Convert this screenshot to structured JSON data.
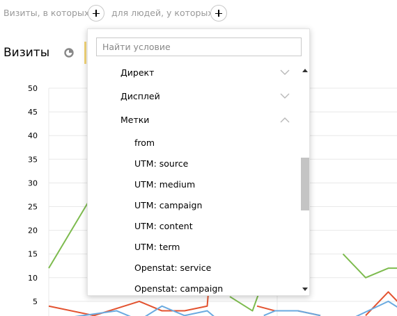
{
  "filter_bar": {
    "visits_label": "Визиты, в которых",
    "people_label": "для людей, у которых"
  },
  "header": {
    "title": "Визиты"
  },
  "dropdown": {
    "search_placeholder": "Найти условие",
    "groups": [
      {
        "label": "Директ",
        "expanded": false
      },
      {
        "label": "Дисплей",
        "expanded": false
      },
      {
        "label": "Метки",
        "expanded": true
      }
    ],
    "sub_items": [
      "from",
      "UTM: source",
      "UTM: medium",
      "UTM: campaign",
      "UTM: content",
      "UTM: term",
      "Openstat: service",
      "Openstat: campaign"
    ]
  },
  "chart_data": {
    "type": "line",
    "ylim": [
      0,
      50
    ],
    "y_ticks": [
      "50",
      "45",
      "40",
      "35",
      "30",
      "25",
      "20",
      "15",
      "10",
      "5"
    ],
    "grid": true,
    "series": [
      {
        "color": "#7dbb4e",
        "points": [
          [
            0,
            12
          ],
          [
            2,
            28
          ],
          [
            3,
            29
          ]
        ]
      },
      {
        "color": "#7dbb4e",
        "points": [
          [
            8,
            6
          ],
          [
            9,
            3
          ],
          [
            9.3,
            7
          ]
        ]
      },
      {
        "color": "#7dbb4e",
        "points": [
          [
            13,
            15
          ],
          [
            14,
            10
          ],
          [
            15,
            12
          ],
          [
            16,
            12
          ],
          [
            17,
            13
          ]
        ]
      },
      {
        "color": "#e3522f",
        "points": [
          [
            0,
            4
          ],
          [
            2,
            2
          ],
          [
            4,
            5
          ],
          [
            5,
            3
          ],
          [
            6,
            3
          ],
          [
            7,
            4
          ],
          [
            7.3,
            21
          ]
        ]
      },
      {
        "color": "#e3522f",
        "points": [
          [
            9.2,
            4
          ],
          [
            10,
            3
          ],
          [
            11,
            3
          ],
          [
            12,
            2
          ]
        ]
      },
      {
        "color": "#e3522f",
        "points": [
          [
            14,
            2
          ],
          [
            15,
            7
          ],
          [
            16,
            2
          ],
          [
            17,
            6
          ],
          [
            17.5,
            4
          ]
        ]
      },
      {
        "color": "#6aaae0",
        "points": [
          [
            0,
            1
          ],
          [
            3,
            3
          ],
          [
            4,
            1
          ],
          [
            5,
            4
          ],
          [
            6,
            2
          ],
          [
            7,
            3
          ],
          [
            7.5,
            1
          ]
        ]
      },
      {
        "color": "#6aaae0",
        "points": [
          [
            9.5,
            2
          ],
          [
            10,
            3
          ],
          [
            11,
            3
          ],
          [
            12,
            2
          ]
        ]
      },
      {
        "color": "#6aaae0",
        "points": [
          [
            13,
            0.5
          ],
          [
            15,
            5
          ],
          [
            16,
            2
          ],
          [
            17,
            3
          ]
        ]
      }
    ]
  },
  "colors": {
    "accent_green": "#7dbb4e",
    "accent_red": "#e3522f",
    "accent_blue": "#6aaae0"
  }
}
